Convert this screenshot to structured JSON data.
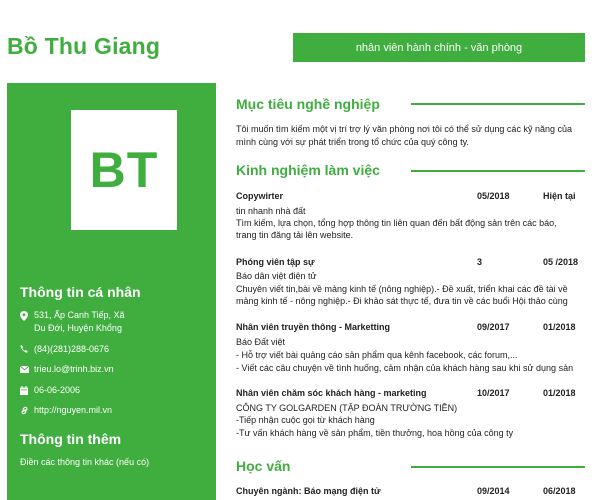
{
  "header": {
    "name": "Bồ Thu Giang",
    "position": "nhân viên hành chính - văn phòng"
  },
  "sidebar": {
    "initials": "BT",
    "personal_heading": "Thông tin cá nhân",
    "address_line1": "531, Ấp Canh Tiếp, Xã",
    "address_line2": "Du Đới, Huyện Khổng",
    "phone": "(84)(281)288-0676",
    "email": "trieu.lo@trinh.biz.vn",
    "birthday": "06-06-2006",
    "website": "http://nguyen.mil.vn",
    "more_heading": "Thông tin thêm",
    "more_text": "Điền các thông tin khác (nếu có)"
  },
  "objective": {
    "heading": "Mục tiêu nghề nghiệp",
    "line1": "Tôi muốn tìm kiếm một vị trí trợ lý văn phòng nơi tôi có thể sử dụng các kỹ năng của",
    "line2": "mình cùng với sự phát triển trong tổ chức của quý công ty."
  },
  "experience": {
    "heading": "Kinh nghiệm làm việc",
    "jobs": [
      {
        "title": "Copywirter",
        "start": "05/2018",
        "end": "Hiện tại",
        "lines": [
          "tin nhanh nhà đất",
          "Tìm kiếm, lựa chọn, tổng hợp thông tin liên quan đến bất động sản trên các báo,",
          "trang tin đăng tải lên website."
        ]
      },
      {
        "title": "Phóng viên tập sự",
        "start": "3",
        "end": "05 /2018",
        "lines": [
          "Báo dân việt điện tử",
          "Chuyên viết tin,bài về mảng kinh tế (nông nghiệp).- Đề xuất, triển khai các đề tài về",
          "mảng kinh tế - nông nghiệp.- Đi khảo sát thực tế, đưa tin về các buổi Hội thảo cùng"
        ]
      },
      {
        "title": "Nhân viên truyền thông - Marketting",
        "start": "09/2017",
        "end": "01/2018",
        "lines": [
          "Báo Đất việt",
          "- Hỗ trợ viết bài quảng cáo sản phẩm qua kênh facebook, các forum,...",
          "- Viết các câu chuyện về tình huống, cảm nhận của khách hàng sau khi sử dụng sản"
        ]
      },
      {
        "title": "Nhân viên chăm sóc khách hàng - marketing",
        "start": "10/2017",
        "end": "01/2018",
        "lines": [
          "CÔNG TY GOLGARDEN (TẬP ĐOÀN TRƯỜNG TIỀN)",
          "-Tiếp nhận cuộc gọi từ khách hàng",
          "-Tư vấn khách hàng về sản phẩm, tiền thưởng, hoa hồng của công ty"
        ]
      }
    ]
  },
  "education": {
    "heading": "Học vấn",
    "major": "Chuyên ngành: Báo mạng điện tử",
    "start": "09/2014",
    "end": "06/2018"
  },
  "colors": {
    "accent": "#3fae3f"
  }
}
